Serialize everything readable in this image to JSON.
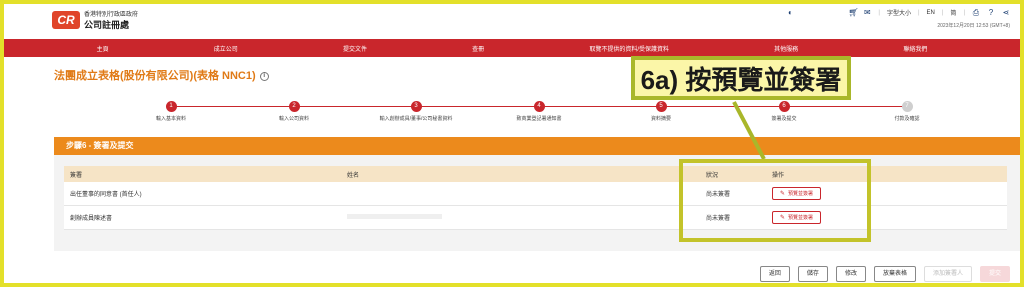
{
  "header": {
    "logo_abbr": "CR",
    "logo_sub": "香港特別行政區政府",
    "logo_main": "公司註冊處",
    "font_size_label": "字型大小",
    "lang_en": "EN",
    "lang_zh": "简",
    "timestamp": "2023年12月20日 12:53 (GMT+8)"
  },
  "nav": {
    "items": [
      "主頁",
      "成立公司",
      "提交文件",
      "查冊",
      "取覽不提供的資料/受保護資料",
      "其他服務",
      "聯絡我們"
    ]
  },
  "page": {
    "title": "法團成立表格(股份有限公司)(表格 NNC1)",
    "info_symbol": "i"
  },
  "steps": [
    {
      "num": "1",
      "label": "輸入基本資料",
      "active": true
    },
    {
      "num": "2",
      "label": "輸入公司資料",
      "active": true
    },
    {
      "num": "3",
      "label": "輸入創辦成員/董事/公司秘書資料",
      "active": true
    },
    {
      "num": "4",
      "label": "致商業登記署通知書",
      "active": true
    },
    {
      "num": "5",
      "label": "資料摘要",
      "active": true
    },
    {
      "num": "6",
      "label": "簽署及提交",
      "active": true
    },
    {
      "num": "7",
      "label": "付款及確認",
      "active": false
    }
  ],
  "panel": {
    "title": "步驟6 - 簽署及提交",
    "columns": [
      "簽署",
      "姓名",
      "狀況",
      "操作"
    ],
    "rows": [
      {
        "signer": "出任董事的同意書 (首任人)",
        "name": "",
        "status": "尚未簽署",
        "action": "預覽並簽署"
      },
      {
        "signer": "創辦成員陳述書",
        "name": "",
        "status": "尚未簽署",
        "action": "預覽並簽署"
      }
    ]
  },
  "callout": {
    "text": "6a) 按預覽並簽署"
  },
  "bottom_buttons": {
    "back": "返回",
    "save": "儲存",
    "edit": "修改",
    "abandon": "放棄表格",
    "add_signer": "添加簽署人",
    "submit": "提交"
  },
  "colors": {
    "brand_red": "#c9262c",
    "orange": "#ec8a1c",
    "callout_border": "#a9b72a",
    "callout_bg": "#fbf6a8",
    "frame_yellow": "#e3e02a"
  }
}
